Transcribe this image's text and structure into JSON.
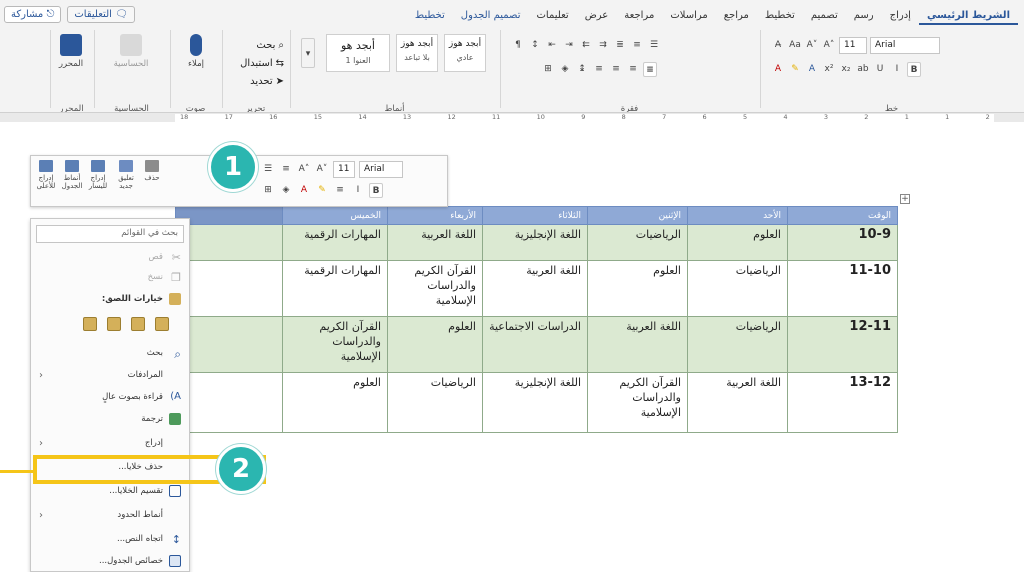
{
  "ribbon": {
    "tabs": [
      "الشريط الرئيسي",
      "إدراج",
      "رسم",
      "تصميم",
      "تخطيط",
      "مراجع",
      "مراسلات",
      "مراجعة",
      "عرض",
      "تعليمات",
      "تصميم الجدول",
      "تخطيط"
    ],
    "active_tab": "الشريط الرئيسي",
    "comments_label": "التعليقات",
    "share_label": "مشاركة",
    "groups": {
      "font": {
        "label": "خط",
        "font_name": "Arial",
        "font_size": "11"
      },
      "paragraph": {
        "label": "فقرة"
      },
      "styles": {
        "label": "أنماط",
        "items": [
          {
            "sample": "أبجد هوز",
            "name": "عادي"
          },
          {
            "sample": "أبجد هوز",
            "name": "بلا تباعد"
          },
          {
            "sample": "أبجد هو",
            "name": "العنوا 1"
          }
        ]
      },
      "editing": {
        "label": "تحرير",
        "find": "بحث",
        "replace": "استبدال",
        "select": "تحديد"
      },
      "voice": {
        "label": "صوت",
        "dictate": "إملاء"
      },
      "sensitivity": {
        "label": "الحساسية",
        "button": "الحساسية"
      },
      "editor": {
        "label": "المحرر",
        "button": "المحرر"
      }
    },
    "ruler_numbers": [
      "18",
      "17",
      "16",
      "15",
      "14",
      "13",
      "12",
      "11",
      "10",
      "9",
      "8",
      "7",
      "6",
      "5",
      "4",
      "3",
      "2",
      "1",
      "1",
      "2"
    ]
  },
  "mini_toolbar": {
    "font_name": "Arial",
    "font_size": "11",
    "buttons": [
      "إدراج للأعلى",
      "أنماط الجدول",
      "إدراج لليسار",
      "تعليق جديد",
      "حذف"
    ]
  },
  "context_menu": {
    "search_placeholder": "بحث في القوائم",
    "items": [
      {
        "label": "قص",
        "enabled": false,
        "submenu": false
      },
      {
        "label": "نسخ",
        "enabled": false,
        "submenu": false
      },
      {
        "label": "خيارات اللصق:",
        "enabled": true,
        "submenu": false
      },
      {
        "label": "بحث",
        "enabled": true,
        "submenu": false
      },
      {
        "label": "المرادفات",
        "enabled": true,
        "submenu": true
      },
      {
        "label": "قراءة بصوت عالٍ",
        "enabled": true,
        "submenu": false
      },
      {
        "label": "ترجمة",
        "enabled": true,
        "submenu": false
      },
      {
        "label": "إدراج",
        "enabled": true,
        "submenu": true
      },
      {
        "label": "حذف خلايا...",
        "enabled": true,
        "submenu": false
      },
      {
        "label": "تقسيم الخلايا...",
        "enabled": true,
        "submenu": false
      },
      {
        "label": "أنماط الحدود",
        "enabled": true,
        "submenu": true
      },
      {
        "label": "اتجاه النص...",
        "enabled": true,
        "submenu": false
      },
      {
        "label": "خصائص الجدول...",
        "enabled": true,
        "submenu": false
      }
    ]
  },
  "callouts": [
    "1",
    "2"
  ],
  "table": {
    "headers": [
      "الوقت",
      "الأحد",
      "الإثنين",
      "الثلاثاء",
      "الأربعاء",
      "الخميس",
      ""
    ],
    "rows": [
      [
        "10-9",
        "العلوم",
        "الرياضيات",
        "اللغة الإنجليزية",
        "اللغة العربية",
        "المهارات الرقمية",
        ""
      ],
      [
        "11-10",
        "الرياضيات",
        "العلوم",
        "اللغة العربية",
        "القرآن الكريم والدراسات الإسلامية",
        "المهارات الرقمية",
        ""
      ],
      [
        "12-11",
        "الرياضيات",
        "اللغة العربية",
        "الدراسات الاجتماعية",
        "العلوم",
        "القرآن الكريم والدراسات الإسلامية",
        ""
      ],
      [
        "13-12",
        "اللغة العربية",
        "القرآن الكريم والدراسات الإسلامية",
        "اللغة الإنجليزية",
        "الرياضيات",
        "العلوم",
        ""
      ]
    ]
  },
  "colors": {
    "accent": "#2b579a",
    "highlight": "#f5c518",
    "callout": "#2bb6b0",
    "header_fill": "#8fa9d6",
    "row_green": "#dbe9d2"
  }
}
